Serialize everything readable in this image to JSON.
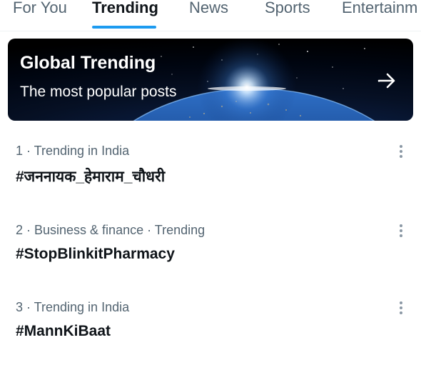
{
  "tabs": [
    {
      "label": "For You",
      "active": false
    },
    {
      "label": "Trending",
      "active": true
    },
    {
      "label": "News",
      "active": false
    },
    {
      "label": "Sports",
      "active": false
    },
    {
      "label": "Entertainm",
      "active": false
    }
  ],
  "colors": {
    "accent": "#1d9bf0",
    "text_primary": "#0f1419",
    "text_secondary": "#536471"
  },
  "banner": {
    "title": "Global Trending",
    "subtitle": "The most popular posts",
    "arrow_icon": "arrow-right-icon"
  },
  "trends": [
    {
      "meta": "1 · Trending in India",
      "title": "#जननायक_हेमाराम_चौधरी",
      "more_icon": "more-vertical-icon"
    },
    {
      "meta": "2 · Business & finance · Trending",
      "title": "#StopBlinkitPharmacy",
      "more_icon": "more-vertical-icon"
    },
    {
      "meta": "3 · Trending in India",
      "title": "#MannKiBaat",
      "more_icon": "more-vertical-icon"
    }
  ]
}
